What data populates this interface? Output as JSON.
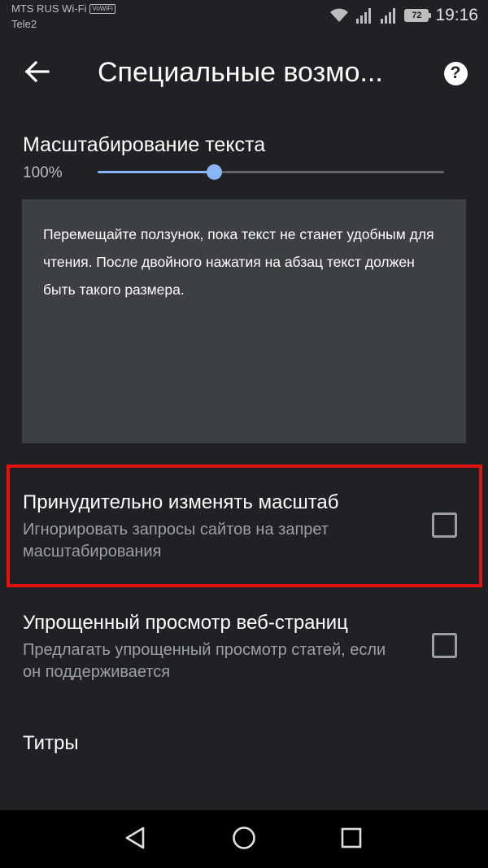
{
  "status_bar": {
    "carrier_primary": "MTS RUS Wi-Fi",
    "vowifi_badge": "VoWiFi",
    "carrier_secondary": "Tele2",
    "battery_level": "72",
    "time": "19:16"
  },
  "toolbar": {
    "title": "Специальные возмо...",
    "back_icon": "arrow-left-icon",
    "help_icon": "help-circle-icon",
    "help_glyph": "?"
  },
  "text_scaling": {
    "title": "Масштабирование текста",
    "value_label": "100%",
    "slider_fraction": 0.335,
    "preview_text": "Перемещайте ползунок, пока текст не станет удобным для чтения. После двойного нажатия на абзац текст должен быть такого размера."
  },
  "settings": [
    {
      "title": "Принудительно изменять масштаб",
      "summary": "Игнорировать запросы сайтов на запрет масштабирования",
      "checked": false
    },
    {
      "title": "Упрощенный просмотр веб-страниц",
      "summary": "Предлагать упрощенный просмотр статей, если он поддерживается",
      "checked": false
    },
    {
      "title": "Титры"
    }
  ],
  "colors": {
    "background": "#202124",
    "accent": "#8ab4f8",
    "highlight": "#e21212"
  },
  "nav_bar": {
    "back_icon": "triangle-back-icon",
    "home_icon": "circle-home-icon",
    "recents_icon": "square-recents-icon"
  }
}
